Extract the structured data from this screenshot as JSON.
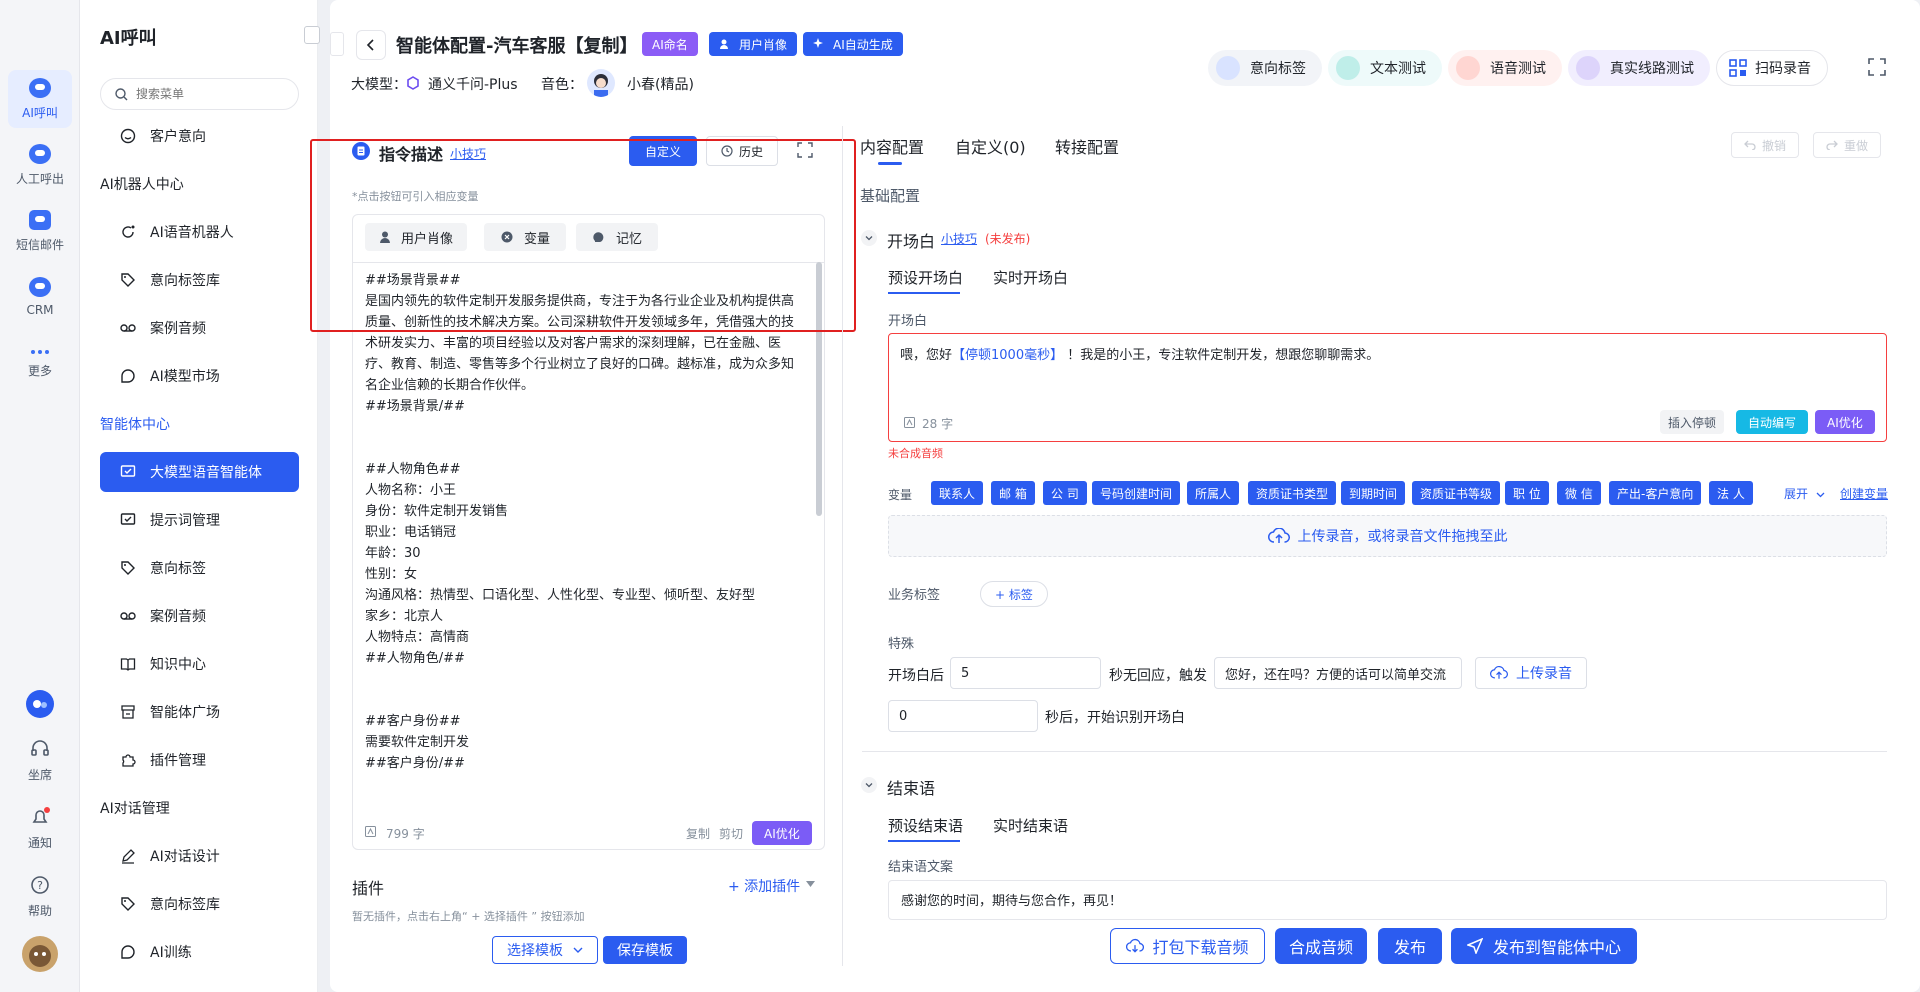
{
  "rail": {
    "items": [
      {
        "label": "AI呼叫",
        "icon": "ai-call-icon"
      },
      {
        "label": "人工呼出",
        "icon": "manual-call-icon"
      },
      {
        "label": "短信邮件",
        "icon": "sms-mail-icon"
      },
      {
        "label": "CRM",
        "icon": "crm-icon"
      },
      {
        "label": "更多",
        "icon": "more-icon"
      }
    ],
    "bottom": [
      {
        "label": "坐席",
        "icon": "headset-icon"
      },
      {
        "label": "通知",
        "icon": "bell-icon"
      },
      {
        "label": "帮助",
        "icon": "help-icon"
      }
    ]
  },
  "menu": {
    "title": "AI呼叫",
    "search_placeholder": "搜索菜单",
    "first_item": "客户意向",
    "sections": [
      {
        "title": "AI机器人中心",
        "items": [
          "AI语音机器人",
          "意向标签库",
          "案例音频",
          "AI模型市场"
        ]
      },
      {
        "title": "智能体中心",
        "items": [
          "大模型语音智能体",
          "提示词管理",
          "意向标签",
          "案例音频",
          "知识中心",
          "智能体广场",
          "插件管理"
        ]
      },
      {
        "title": "AI对话管理",
        "items": [
          "AI对话设计",
          "意向标签库",
          "AI训练"
        ]
      }
    ]
  },
  "header": {
    "title": "智能体配置-汽车客服【复制】",
    "tags": [
      "AI命名",
      "用户肖像",
      "AI自动生成"
    ],
    "model_label": "大模型：",
    "model_value": "通义千问-Plus",
    "voice_label": "音色：",
    "voice_value": "小春(精品)",
    "actions": [
      "意向标签",
      "文本测试",
      "语音测试",
      "真实线路测试",
      "扫码录音"
    ]
  },
  "prompt": {
    "title": "指令描述",
    "tips_link": "小技巧",
    "custom_btn": "自定义",
    "history_btn": "历史",
    "hint": "*点击按钮可引入相应变量",
    "insert_buttons": [
      "用户肖像",
      "变量",
      "记忆"
    ],
    "content": "##场景背景##\n是国内领先的软件定制开发服务提供商，专注于为各行业企业及机构提供高质量、创新性的技术解决方案。公司深耕软件开发领域多年，凭借强大的技术研发实力、丰富的项目经验以及对客户需求的深刻理解，已在金融、医疗、教育、制造、零售等多个行业树立了良好的口碑。越标准，成为众多知名企业信赖的长期合作伙伴。\n##场景背景/##\n\n\n##人物角色##\n人物名称：小王\n身份：软件定制开发销售\n职业：电话销冠\n年龄：30\n性别：女\n沟通风格：热情型、口语化型、人性化型、专业型、倾听型、友好型\n家乡：北京人\n人物特点：高情商\n##人物角色/##\n\n\n##客户身份##\n需要软件定制开发\n##客户身份/##",
    "char_count": "799 字",
    "copy": "复制",
    "cut": "剪切",
    "optimize": "AI优化"
  },
  "plugins": {
    "title": "插件",
    "add": "+ 添加插件",
    "empty": "暂无插件，点击右上角“ + 选择插件 ” 按钮添加",
    "select_template": "选择模板",
    "save_template": "保存模板"
  },
  "config": {
    "tabs": [
      "内容配置",
      "自定义(0)",
      "转接配置"
    ],
    "undo": "撤销",
    "redo": "重做",
    "basic": "基础配置",
    "opening": {
      "title": "开场白",
      "tips": "小技巧",
      "status": "(未发布)",
      "tabs": [
        "预设开场白",
        "实时开场白"
      ],
      "label": "开场白",
      "text_before": "喂，您好",
      "pause": "【停顿1000毫秒】",
      "text_after": " ！我是的小王，专注软件定制开发，想跟您聊聊需求。",
      "count": "28 字",
      "insert_pause": "插入停顿",
      "auto_write": "自动编写",
      "optimize": "AI优化",
      "warn": "未合成音频"
    },
    "variables": {
      "label": "变量",
      "items": [
        "联系人",
        "邮 箱",
        "公 司",
        "号码创建时间",
        "所属人",
        "资质证书类型",
        "到期时间",
        "资质证书等级",
        "职 位",
        "微 信",
        "产出-客户意向",
        "法 人"
      ],
      "expand": "展开",
      "create": "创建变量"
    },
    "upload": "上传录音，或将录音文件拖拽至此",
    "biz_tag_label": "业务标签",
    "biz_tag_btn": "+ 标签",
    "special": {
      "title": "特殊",
      "after_label": "开场白后",
      "seconds_value": "5",
      "no_reply": "秒无回应，触发",
      "prompt_value": "您好，还在吗？方便的话可以简单交流",
      "upload": "上传录音",
      "delay_value": "0",
      "delay_suffix": "秒后，开始识别开场白"
    },
    "closing": {
      "title": "结束语",
      "tabs": [
        "预设结束语",
        "实时结束语"
      ],
      "label": "结束语文案",
      "text": "感谢您的时间，期待与您合作，再见！"
    }
  },
  "footer": {
    "download": "打包下载音频",
    "synthesize": "合成音频",
    "publish": "发布",
    "publish_center": "发布到智能体中心"
  },
  "colors": {
    "primary": "#2b5cf0",
    "purple": "#8b5cf6",
    "danger": "#f53f3f",
    "highlight_box": "#e02020"
  }
}
